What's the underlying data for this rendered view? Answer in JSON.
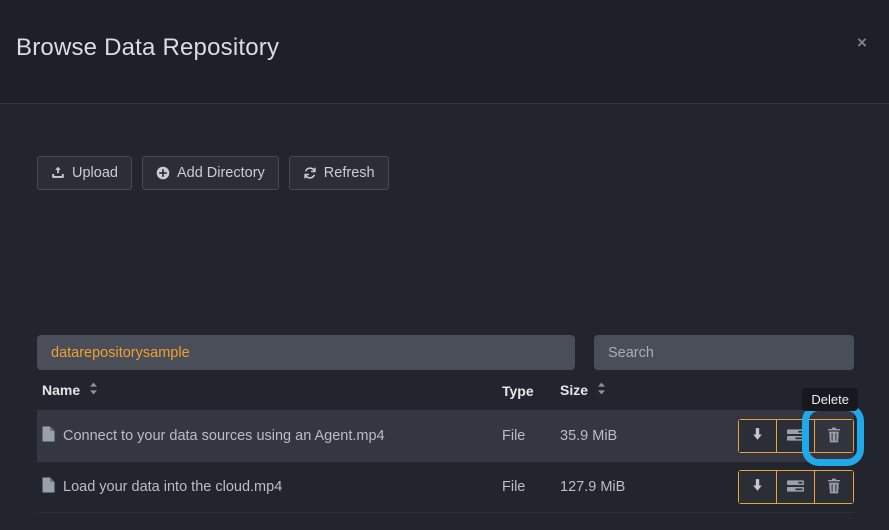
{
  "modal": {
    "title": "Browse Data Repository",
    "close_label": "×",
    "close_icon": "close-icon"
  },
  "toolbar": {
    "buttons": [
      {
        "label": "Upload",
        "icon": "upload-icon"
      },
      {
        "label": "Add Directory",
        "icon": "plus-circle-icon"
      },
      {
        "label": "Refresh",
        "icon": "refresh-icon"
      }
    ]
  },
  "path": {
    "breadcrumb": "datarepositorysample"
  },
  "search": {
    "placeholder": "Search",
    "value": ""
  },
  "table": {
    "headers": {
      "name": "Name",
      "type": "Type",
      "size": "Size"
    },
    "rows": [
      {
        "name": "Connect to your data sources using an Agent.mp4",
        "type": "File",
        "size": "35.9 MiB",
        "icon": "file-icon",
        "hovered": true
      },
      {
        "name": "Load your data into the cloud.mp4",
        "type": "File",
        "size": "127.9 MiB",
        "icon": "file-icon",
        "hovered": false
      }
    ],
    "actions": {
      "download": "download-icon",
      "details": "server-list-icon",
      "delete": "trash-icon"
    }
  },
  "tooltip": {
    "text": "Delete"
  },
  "colors": {
    "accent_orange": "#f0a030",
    "button_border_orange": "#e8a33d",
    "focus_ring_cyan": "#20a9e8",
    "background": "#22252d",
    "header_background": "#1e2027",
    "row_hover": "#343741",
    "input_background": "#4a4e59"
  }
}
